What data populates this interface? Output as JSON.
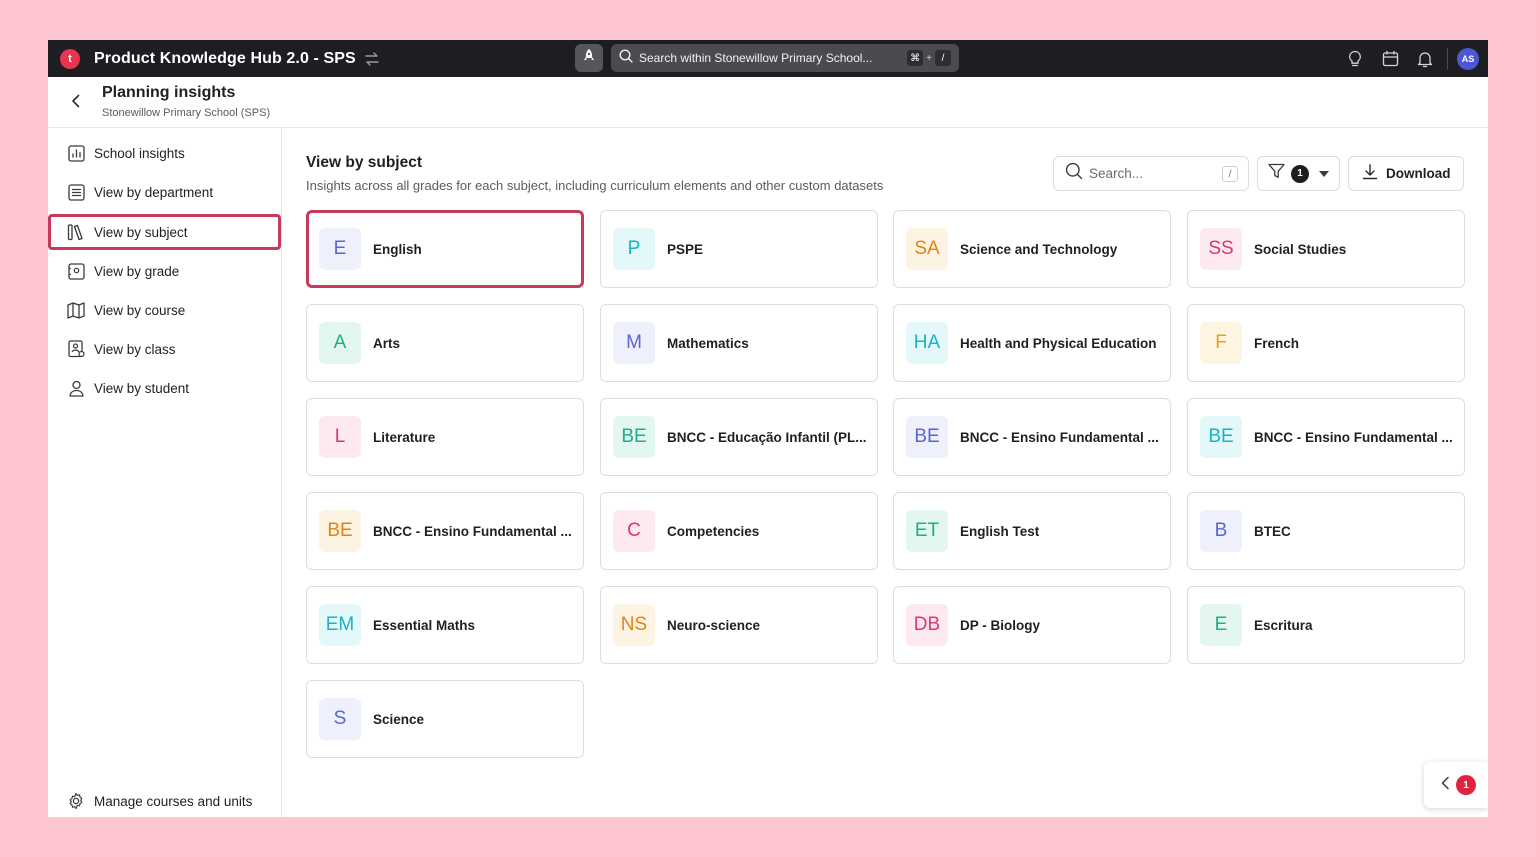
{
  "topbar": {
    "title": "Product Knowledge Hub 2.0 - SPS",
    "logo_letter": "t",
    "search_placeholder": "Search within Stonewillow Primary School...",
    "shortcut_keys": [
      "⌘",
      "+",
      "/"
    ],
    "avatar_initials": "AS"
  },
  "header": {
    "title": "Planning insights",
    "subtitle": "Stonewillow Primary School (SPS)"
  },
  "sidebar": {
    "items": [
      {
        "label": "School insights",
        "icon": "chart-icon"
      },
      {
        "label": "View by department",
        "icon": "list-icon"
      },
      {
        "label": "View by subject",
        "icon": "books-icon",
        "active": true
      },
      {
        "label": "View by grade",
        "icon": "grade-icon"
      },
      {
        "label": "View by course",
        "icon": "map-icon"
      },
      {
        "label": "View by class",
        "icon": "class-icon"
      },
      {
        "label": "View by student",
        "icon": "student-icon"
      }
    ],
    "bottom_item": {
      "label": "Manage courses and units",
      "icon": "gear-icon"
    }
  },
  "main": {
    "title": "View by subject",
    "subtitle": "Insights across all grades for each subject, including curriculum elements and other custom datasets",
    "search_placeholder": "Search...",
    "search_shortcut": "/",
    "filter_count": "1",
    "download_label": "Download"
  },
  "subjects": [
    {
      "abbr": "E",
      "name": "English",
      "fg": "#5b63d9",
      "bg": "#eef0fc",
      "selected": true
    },
    {
      "abbr": "P",
      "name": "PSPE",
      "fg": "#16b3c4",
      "bg": "#e4f8fa"
    },
    {
      "abbr": "SA",
      "name": "Science and Technology",
      "fg": "#e8820e",
      "bg": "#fdf3e2"
    },
    {
      "abbr": "SS",
      "name": "Social Studies",
      "fg": "#e2336d",
      "bg": "#fdeaf0"
    },
    {
      "abbr": "A",
      "name": "Arts",
      "fg": "#19b08a",
      "bg": "#e3f7f0"
    },
    {
      "abbr": "M",
      "name": "Mathematics",
      "fg": "#5b63d9",
      "bg": "#eef0fc"
    },
    {
      "abbr": "HA",
      "name": "Health and Physical Education",
      "fg": "#16b3c4",
      "bg": "#e4f8fa"
    },
    {
      "abbr": "F",
      "name": "French",
      "fg": "#e8a20e",
      "bg": "#fdf5e2"
    },
    {
      "abbr": "L",
      "name": "Literature",
      "fg": "#e2336d",
      "bg": "#fdeaf0"
    },
    {
      "abbr": "BE",
      "name": "BNCC - Educação Infantil (PL...",
      "fg": "#19b08a",
      "bg": "#e3f7f0"
    },
    {
      "abbr": "BE",
      "name": "BNCC - Ensino Fundamental ...",
      "fg": "#5b63d9",
      "bg": "#eef0fc"
    },
    {
      "abbr": "BE",
      "name": "BNCC - Ensino Fundamental ...",
      "fg": "#16b3c4",
      "bg": "#e4f8fa"
    },
    {
      "abbr": "BE",
      "name": "BNCC - Ensino Fundamental ...",
      "fg": "#e8820e",
      "bg": "#fdf3e2"
    },
    {
      "abbr": "C",
      "name": "Competencies",
      "fg": "#e2336d",
      "bg": "#fdeaf0"
    },
    {
      "abbr": "ET",
      "name": "English Test",
      "fg": "#19b08a",
      "bg": "#e3f7f0"
    },
    {
      "abbr": "B",
      "name": "BTEC",
      "fg": "#5b63d9",
      "bg": "#eef0fc"
    },
    {
      "abbr": "EM",
      "name": "Essential Maths",
      "fg": "#16b3c4",
      "bg": "#e4f8fa"
    },
    {
      "abbr": "NS",
      "name": "Neuro-science",
      "fg": "#e8820e",
      "bg": "#fdf3e2"
    },
    {
      "abbr": "DB",
      "name": "DP - Biology",
      "fg": "#e2336d",
      "bg": "#fdeaf0"
    },
    {
      "abbr": "E",
      "name": "Escritura",
      "fg": "#19b08a",
      "bg": "#e3f7f0"
    },
    {
      "abbr": "S",
      "name": "Science",
      "fg": "#5b63d9",
      "bg": "#eef0fc"
    }
  ],
  "float_panel": {
    "count": "1"
  }
}
